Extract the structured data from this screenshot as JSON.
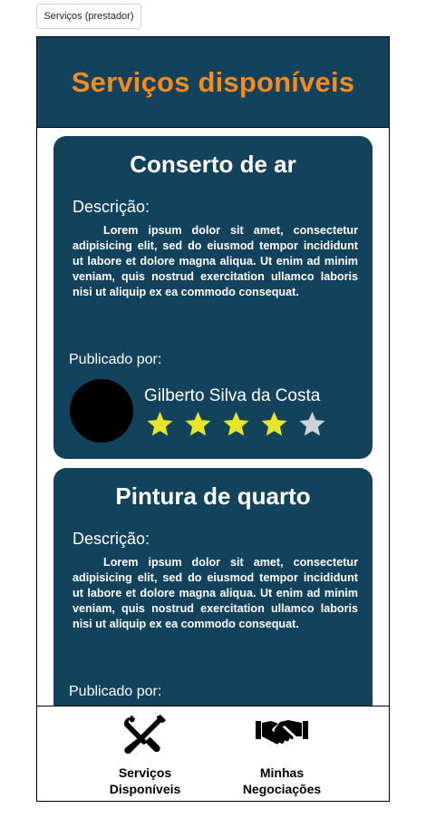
{
  "tab_label": "Serviços (prestador)",
  "header": {
    "title": "Serviços disponíveis"
  },
  "services": [
    {
      "title": "Conserto de ar",
      "description_label": "Descrição:",
      "description": "Lorem ipsum dolor sit amet, consectetur adipisicing elit, sed do eiusmod tempor incididunt ut labore et dolore magna aliqua. Ut enim ad minim veniam, quis nostrud exercitation ullamco laboris nisi ut aliquip ex ea commodo consequat.",
      "published_by_label": "Publicado por:",
      "publisher_name": "Gilberto Silva da Costa",
      "rating": 4,
      "rating_max": 5
    },
    {
      "title": "Pintura de quarto",
      "description_label": "Descrição:",
      "description": "Lorem ipsum dolor sit amet, consectetur adipisicing elit, sed do eiusmod tempor incididunt ut labore et dolore magna aliqua. Ut enim ad minim veniam, quis nostrud exercitation ullamco laboris nisi ut aliquip ex ea commodo consequat.",
      "published_by_label": "Publicado por:"
    }
  ],
  "footer": {
    "items": [
      {
        "label": "Serviços\nDisponíveis",
        "icon": "tools-icon"
      },
      {
        "label": "Minhas\nNegociações",
        "icon": "handshake-icon"
      }
    ]
  },
  "colors": {
    "header_bg": "#13425c",
    "title_orange": "#f58a1f",
    "card_bg": "#13425c",
    "star_filled": "#e6e62b",
    "star_empty": "#cfd3d6"
  }
}
